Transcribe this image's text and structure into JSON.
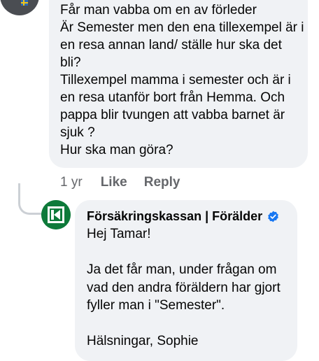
{
  "comment": {
    "text": "Får man vabba om en av förleder\nÄr Semester men den ena tillexempel är i en resa annan land/ ställe hur ska det bli?\nTillexempel mamma i semester och är i en resa utanför bort från Hemma. Och pappa blir tvungen att vabba barnet är sjuk ?\nHur ska man göra?",
    "time": "1 yr",
    "like_label": "Like",
    "reply_label": "Reply"
  },
  "reply": {
    "author": "Försäkringskassan | Förälder",
    "text": "Hej Tamar!\n\nJa det får man, under frågan om vad den andra föräldern har gjort fyller man i \"Semester\".\n\nHälsningar, Sophie"
  },
  "colors": {
    "bubble": "#f0f2f5",
    "secondary_text": "#65676b",
    "verified": "#1877f2",
    "brand_green": "#0e7a3a"
  }
}
